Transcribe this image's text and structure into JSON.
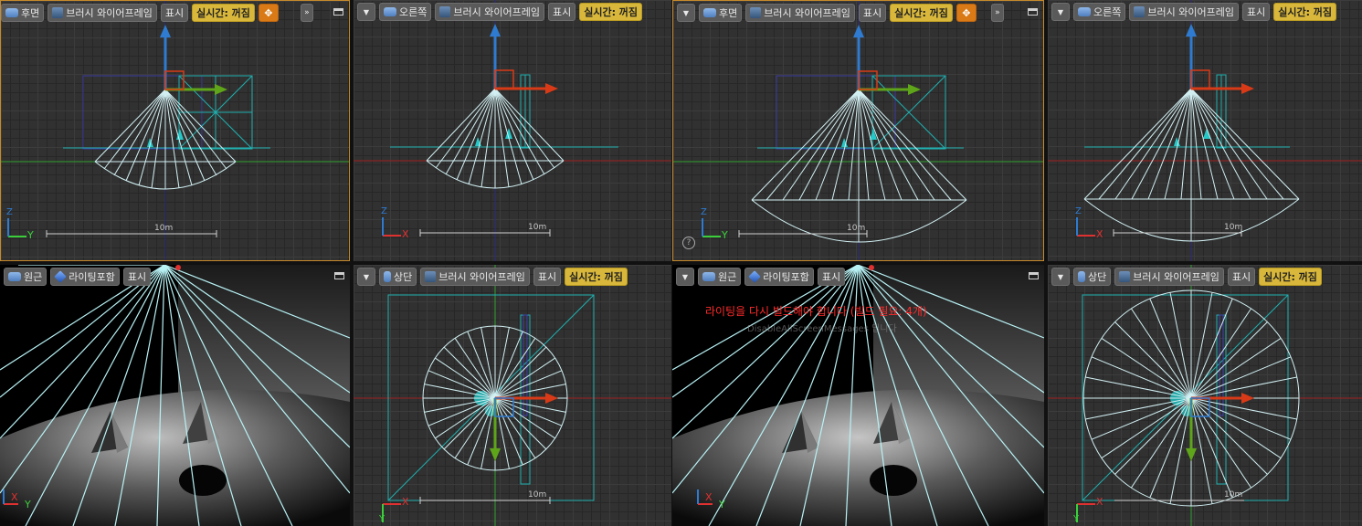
{
  "labels": {
    "back": "후면",
    "right": "오른쪽",
    "top": "상단",
    "perspective": "원근",
    "brush_wireframe": "브러시 와이어프레임",
    "lit": "라이팅포함",
    "show": "표시",
    "realtime_off": "실시간: 꺼짐",
    "scale": "10m",
    "axis_x": "X",
    "axis_y": "Y",
    "axis_z": "Z",
    "help": "?"
  },
  "warning": {
    "text": "라이팅을 다시 빌드해야 합니다 (빌드 필요: 4개)",
    "faded": "DisableAllScreenMessages 입니다"
  },
  "icons": [
    "view-icon",
    "mode-icon",
    "dropdown-icon",
    "move-icon",
    "more-icon",
    "maximize-icon"
  ],
  "colors": {
    "active_border": "#c68a2b",
    "realtime_badge": "#d8b73a",
    "wire": "#cfeff2",
    "gizmo_x": "#d83a17",
    "gizmo_y": "#5fa51a",
    "gizmo_z": "#2e7bd1"
  }
}
